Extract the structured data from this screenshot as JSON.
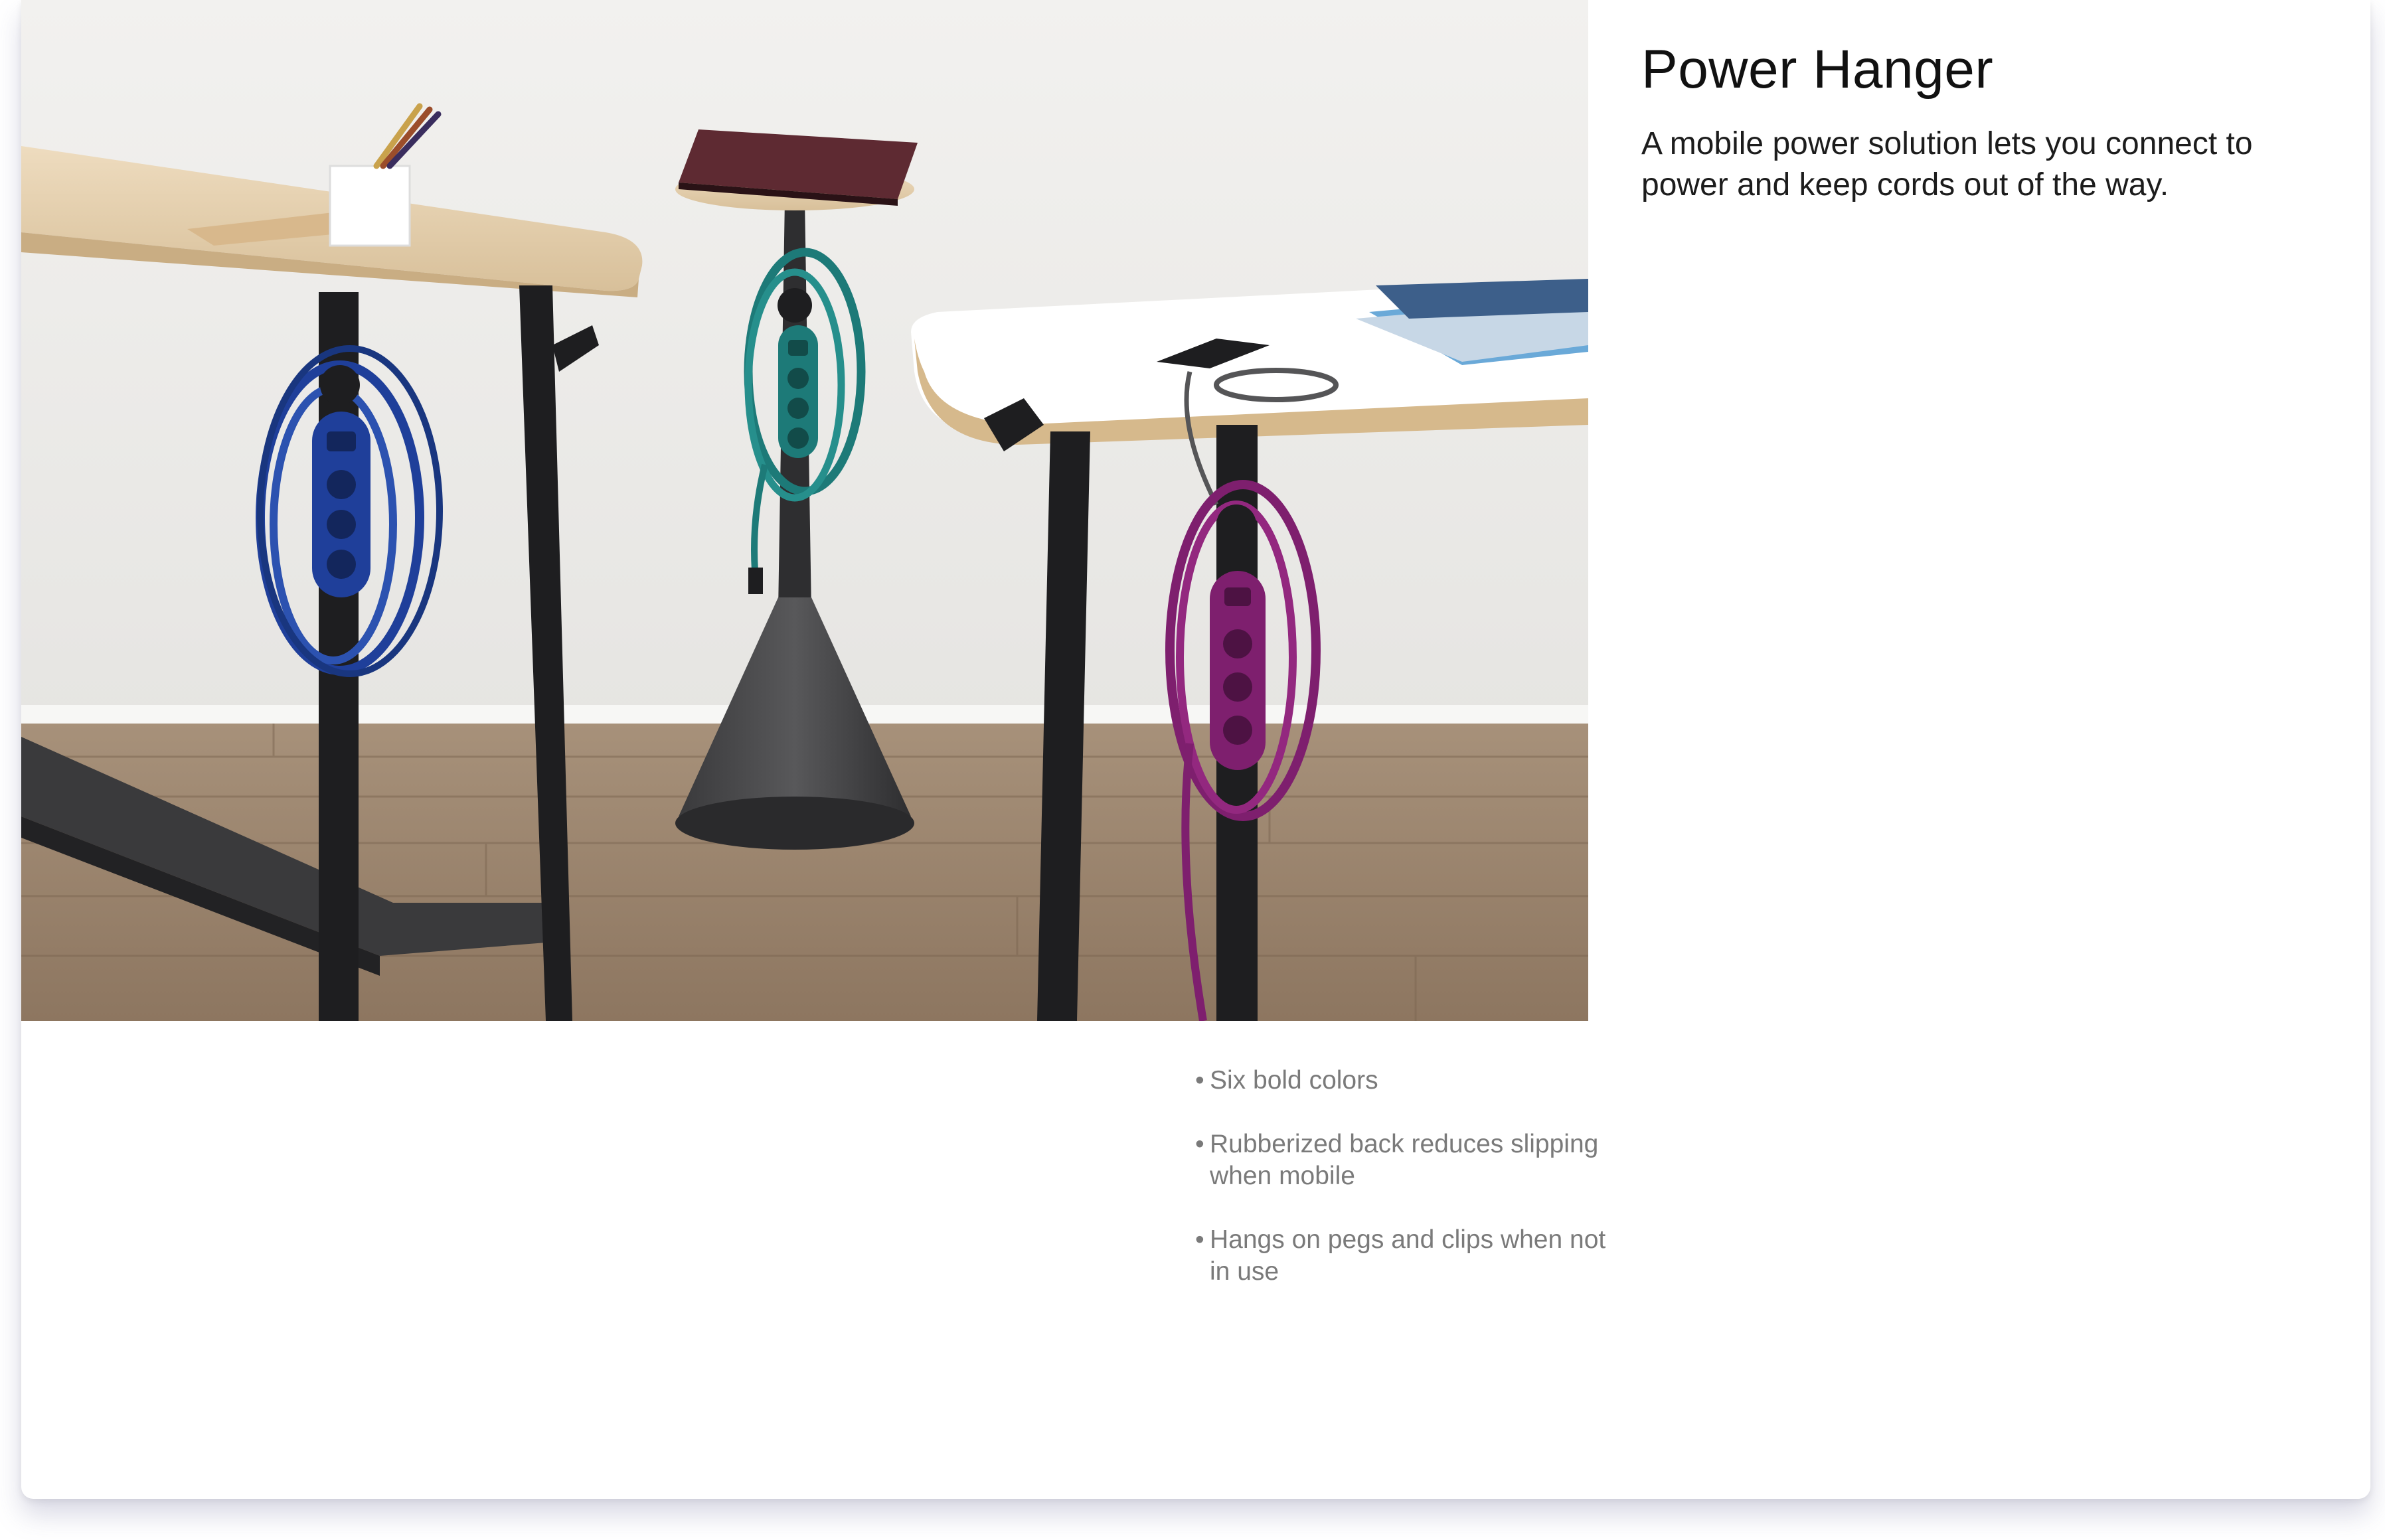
{
  "product": {
    "title": "Power Hanger",
    "description": "A mobile power solution lets you connect to power and keep cords out of the way."
  },
  "features": [
    {
      "bullet": "•",
      "text": "Six bold colors"
    },
    {
      "bullet": "•",
      "text": "Rubberized back reduces slipping when mobile"
    },
    {
      "bullet": "•",
      "text": "Hangs on pegs and clips when not in use"
    }
  ],
  "photo": {
    "power_hanger_colors": [
      "#1f3f9a",
      "#1d7a78",
      "#7e1f6e"
    ]
  }
}
